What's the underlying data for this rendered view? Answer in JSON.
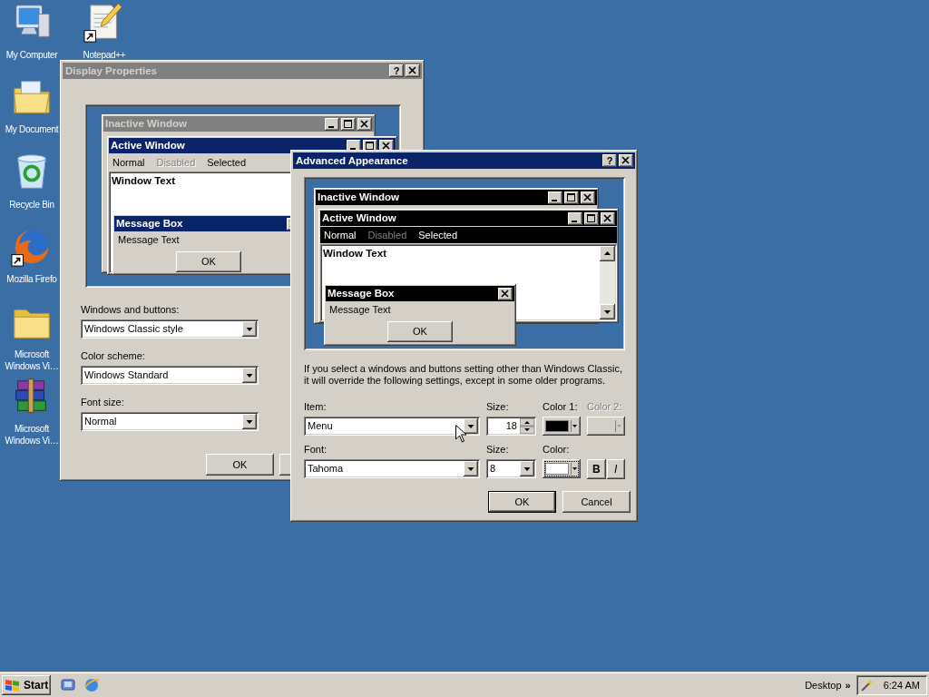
{
  "desktop_icons": [
    {
      "label": "My Computer",
      "kind": "computer",
      "shortcut": false
    },
    {
      "label": "Notepad++",
      "kind": "notepad",
      "shortcut": true
    },
    {
      "label": "My Document",
      "kind": "documents",
      "shortcut": false
    },
    {
      "label": "Recycle Bin",
      "kind": "recycle",
      "shortcut": false
    },
    {
      "label": "Mozilla Firefo",
      "kind": "browser",
      "shortcut": true
    },
    {
      "label": "Microsoft Windows Vi…",
      "kind": "folder",
      "shortcut": false
    },
    {
      "label": "Microsoft Windows Vi…",
      "kind": "archive",
      "shortcut": false
    }
  ],
  "display_properties": {
    "title": "Display Properties",
    "active": false,
    "help": "?",
    "preview": {
      "kind": "classic",
      "inactive_title": "Inactive Window",
      "active_title": "Active Window",
      "menu": [
        {
          "label": "Normal",
          "disabled": false
        },
        {
          "label": "Disabled",
          "disabled": true
        },
        {
          "label": "Selected",
          "disabled": false
        }
      ],
      "window_text": "Window Text",
      "message_title": "Message Box",
      "message_text": "Message Text",
      "button": "OK"
    },
    "fields": [
      {
        "label": "Windows and buttons:",
        "value": "Windows Classic style"
      },
      {
        "label": "Color scheme:",
        "value": "Windows Standard"
      },
      {
        "label": "Font size:",
        "value": "Normal"
      }
    ],
    "buttons": [
      "OK"
    ]
  },
  "advanced": {
    "title": "Advanced Appearance",
    "active": true,
    "help": "?",
    "preview": {
      "kind": "dark",
      "scrollbar": true,
      "inactive_title": "Inactive Window",
      "active_title": "Active Window",
      "menu": [
        {
          "label": "Normal",
          "disabled": false
        },
        {
          "label": "Disabled",
          "disabled": true
        },
        {
          "label": "Selected",
          "disabled": false
        }
      ],
      "window_text": "Window Text",
      "message_title": "Message Box",
      "message_text": "Message Text",
      "button": "OK"
    },
    "note": "If you select a windows and buttons setting other than Windows Classic, it will override the following settings, except in some older programs.",
    "rows": [
      [
        {
          "kind": "combo",
          "label": "Item:",
          "value": "Menu"
        },
        {
          "kind": "spin",
          "label": "Size:",
          "value": "18"
        },
        {
          "kind": "color",
          "label": "Color 1:",
          "color": "#000000",
          "disabled": false,
          "focused": false
        },
        {
          "kind": "color",
          "label": "Color 2:",
          "disabled": true,
          "focused": false
        }
      ],
      [
        {
          "kind": "combo",
          "label": "Font:",
          "value": "Tahoma"
        },
        {
          "kind": "combo",
          "label": "Size:",
          "value": "8"
        },
        {
          "kind": "color",
          "label": "Color:",
          "color": "#ffffff",
          "disabled": false,
          "focused": true
        },
        {
          "kind": "toggles",
          "items": [
            {
              "label": "B",
              "on": false
            },
            {
              "label": "I",
              "on": false
            }
          ]
        }
      ]
    ],
    "buttons": [
      {
        "label": "OK",
        "default": true
      },
      {
        "label": "Cancel",
        "default": false
      }
    ]
  },
  "taskbar": {
    "start": "Start",
    "quick_launch": [
      {
        "kind": "show-desktop"
      },
      {
        "kind": "browser"
      }
    ],
    "toolbar": "Desktop",
    "chevron": "»",
    "clock": "6:24 AM"
  }
}
